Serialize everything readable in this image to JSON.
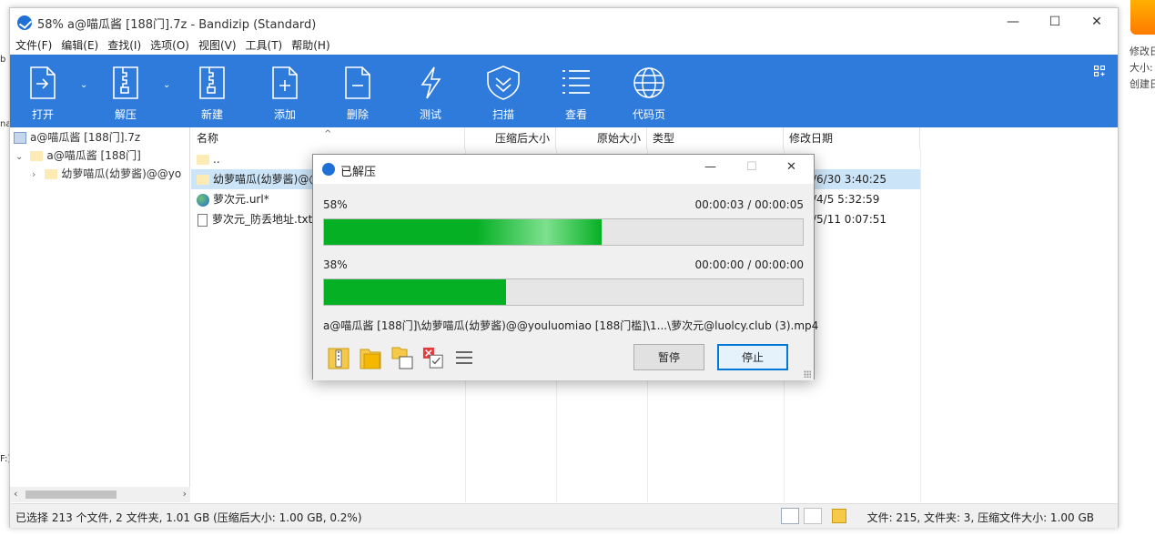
{
  "desktop_left": [
    "b",
    "na",
    "F:)"
  ],
  "desktop_right": [
    "修改日",
    "大小:",
    "创建日"
  ],
  "window": {
    "title": "58% a@喵瓜酱 [188门].7z - Bandizip (Standard)",
    "controls": [
      "—",
      "☐",
      "✕"
    ]
  },
  "menu": [
    "文件(F)",
    "编辑(E)",
    "查找(I)",
    "选项(O)",
    "视图(V)",
    "工具(T)",
    "帮助(H)"
  ],
  "toolbar": [
    "打开",
    "解压",
    "新建",
    "添加",
    "删除",
    "测试",
    "扫描",
    "查看",
    "代码页"
  ],
  "tree": {
    "archive": "a@喵瓜酱 [188门].7z",
    "root": "a@喵瓜酱 [188门]",
    "child": "幼萝喵瓜(幼萝酱)@@yo"
  },
  "columns": [
    "名称",
    "压缩后大小",
    "原始大小",
    "类型",
    "修改日期"
  ],
  "files": [
    {
      "name": "..",
      "date": ""
    },
    {
      "name": "幼萝喵瓜(幼萝酱)@@",
      "date": "/6/30 3:40:25"
    },
    {
      "name": "萝次元.url*",
      "date": "/4/5 5:32:59"
    },
    {
      "name": "萝次元_防丢地址.txt*",
      "date": "/5/11 0:07:51"
    }
  ],
  "status": {
    "left": "已选择 213 个文件, 2 文件夹, 1.01 GB (压缩后大小: 1.00 GB, 0.2%)",
    "right": "文件: 215, 文件夹: 3, 压缩文件大小: 1.00 GB"
  },
  "dialog": {
    "title": "已解压",
    "controls": [
      "—",
      "☐",
      "✕"
    ],
    "p1": {
      "percent_text": "58%",
      "time": "00:00:03 / 00:00:05",
      "progress": 0.58
    },
    "p2": {
      "percent_text": "38%",
      "time": "00:00:00 / 00:00:00",
      "progress": 0.38
    },
    "current_file": "a@喵瓜酱 [188门]\\幼萝喵瓜(幼萝酱)@@youluomiao [188门槛]\\1...\\萝次元@luolcy.club (3).mp4",
    "pause_label": "暂停",
    "stop_label": "停止"
  }
}
